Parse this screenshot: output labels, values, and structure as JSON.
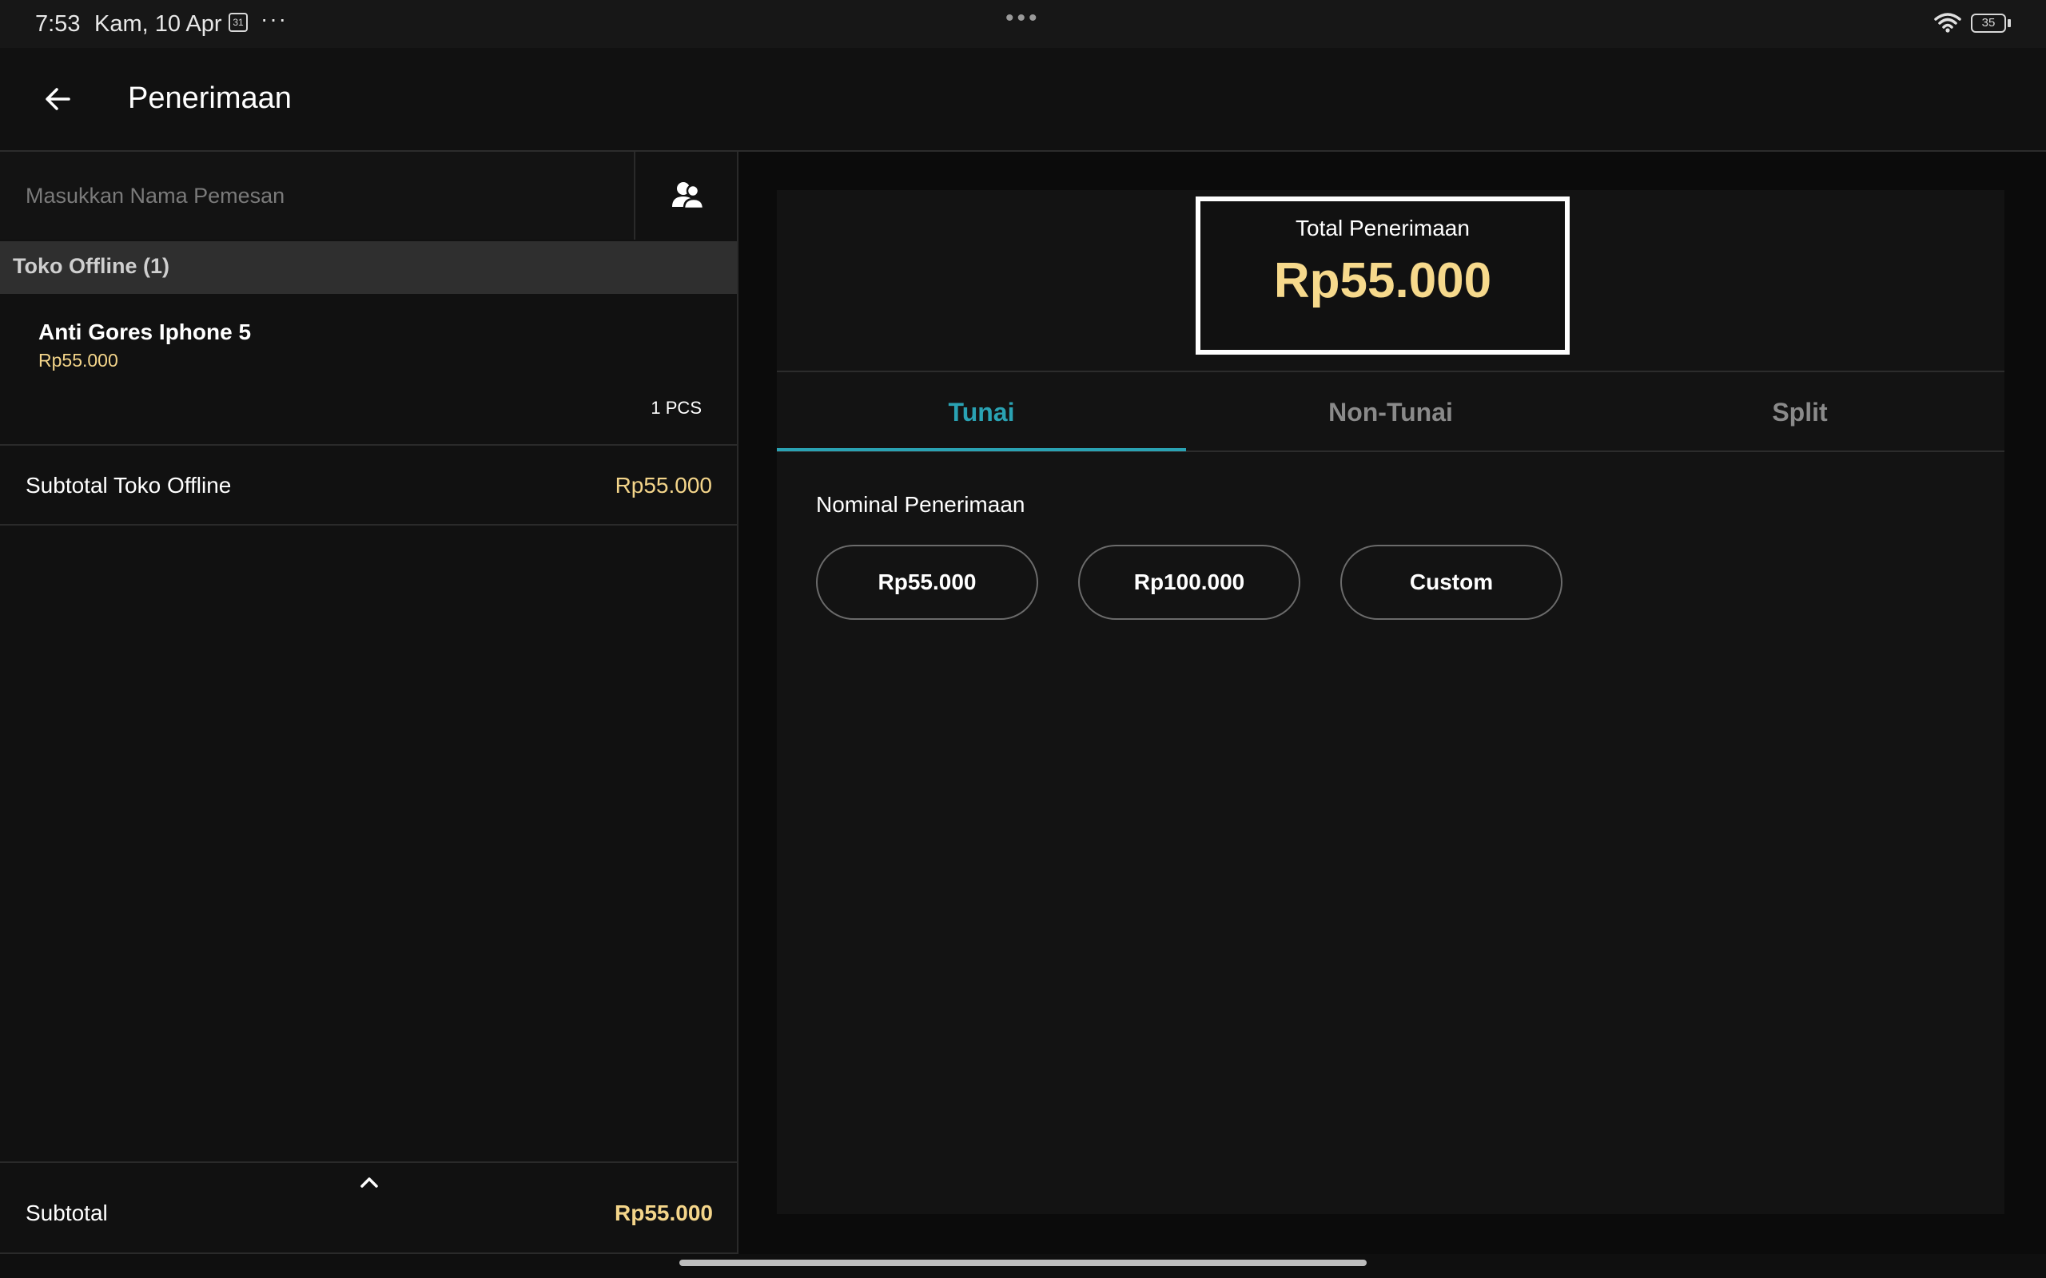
{
  "status_bar": {
    "time": "7:53",
    "date": "Kam, 10 Apr",
    "calendar_day": "31",
    "more": "···",
    "center_dots": "•••",
    "battery": "35"
  },
  "header": {
    "title": "Penerimaan",
    "back_icon": "arrow-left-icon"
  },
  "left": {
    "name_placeholder": "Masukkan Nama Pemesan",
    "name_value": "",
    "contact_icon": "contacts-icon",
    "group_title": "Toko Offline (1)",
    "items": [
      {
        "name": "Anti Gores Iphone 5",
        "price": "Rp55.000",
        "qty": "1 PCS"
      }
    ],
    "subtotal_label": "Subtotal Toko Offline",
    "subtotal_value": "Rp55.000",
    "footer_label": "Subtotal",
    "footer_value": "Rp55.000"
  },
  "right": {
    "total_label": "Total Penerimaan",
    "total_value": "Rp55.000",
    "tabs": [
      {
        "label": "Tunai",
        "active": true
      },
      {
        "label": "Non-Tunai",
        "active": false
      },
      {
        "label": "Split",
        "active": false
      }
    ],
    "nominal_label": "Nominal Penerimaan",
    "nominal_options": [
      "Rp55.000",
      "Rp100.000",
      "Custom"
    ]
  },
  "colors": {
    "accent": "#2aa2b3",
    "amount": "#f4d58a",
    "background": "#0f0f0f"
  }
}
